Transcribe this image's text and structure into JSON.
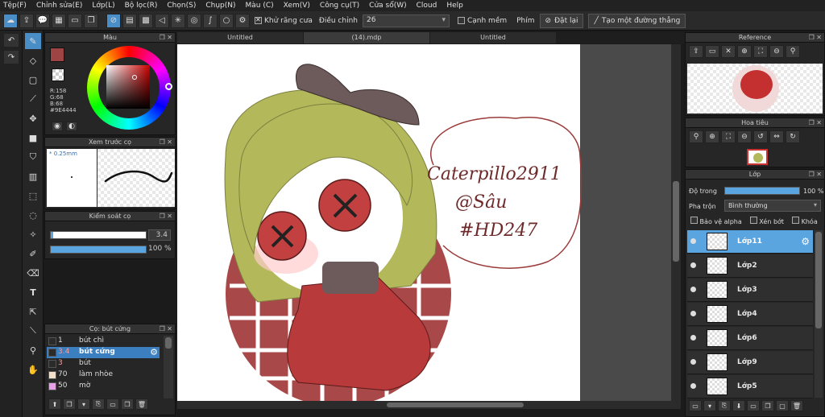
{
  "menu": [
    "Tệp(F)",
    "Chỉnh sửa(E)",
    "Lớp(L)",
    "Bộ lọc(R)",
    "Chọn(S)",
    "Chụp(N)",
    "Màu (C)",
    "Xem(V)",
    "Công cụ(T)",
    "Cửa sổ(W)",
    "Cloud",
    "Help"
  ],
  "toolbar": {
    "antialias_label": "Khử răng cưa",
    "adjust_label": "Điều chỉnh",
    "adjust_value": "26",
    "edge_label": "Cạnh mềm",
    "keys_label": "Phím",
    "reset_label": "Đặt lại",
    "line_label": "Tạo một đường thẳng"
  },
  "panels": {
    "color": {
      "title": "Màu",
      "r": "R:158",
      "g": "G:68",
      "b": "B:68",
      "hex": "#9E4444"
    },
    "brush_preview": {
      "title": "Xem trước cọ",
      "size": "* 0.25mm"
    },
    "brush_control": {
      "title": "Kiểm soát cọ",
      "size_value": "3.4",
      "opacity_value": "100 %"
    },
    "brush_list": {
      "title": "Cọ: bút cứng",
      "items": [
        {
          "size": "1",
          "name": "bút chì",
          "color": "#2b2b2b"
        },
        {
          "size": "3.4",
          "name": "bút cứng",
          "color": "#2b2b2b"
        },
        {
          "size": "3",
          "name": "bút",
          "color": "#2b2b2b"
        },
        {
          "size": "70",
          "name": "làm nhòe",
          "color": "#f3e0c8"
        },
        {
          "size": "50",
          "name": "mờ",
          "color": "#e8a0e8"
        }
      ]
    },
    "reference": {
      "title": "Reference"
    },
    "navigator": {
      "title": "Hoa tiêu"
    },
    "layers": {
      "title": "Lớp",
      "opacity_label": "Độ trong",
      "opacity_value": "100 %",
      "blend_label": "Pha trộn",
      "blend_value": "Bình thường",
      "protect_alpha": "Bảo vệ alpha",
      "clip": "Xén bớt",
      "lock": "Khóa",
      "items": [
        "Lớp11",
        "Lớp2",
        "Lớp3",
        "Lớp4",
        "Lớp6",
        "Lớp9",
        "Lớp5"
      ]
    }
  },
  "tabs": [
    "Untitled",
    "(14).mdp",
    "Untitled"
  ],
  "artwork": {
    "signature": [
      "Caterpillo2911",
      "@Sâu",
      "#HD247"
    ]
  }
}
